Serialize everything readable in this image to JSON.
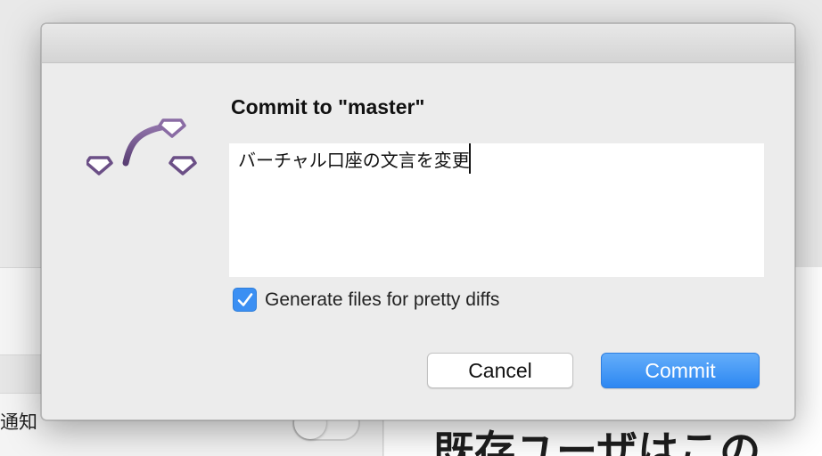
{
  "background": {
    "left_label": "通知",
    "right_heading": "既存ユーザはこの"
  },
  "dialog": {
    "title": "Commit to \"master\"",
    "message": "バーチャル口座の文言を変更",
    "generate_files_checked": true,
    "generate_files_label": "Generate files for pretty diffs",
    "cancel_label": "Cancel",
    "commit_label": "Commit"
  },
  "colors": {
    "accent": "#3b8ff3",
    "icon_purple": "#6b4f86"
  },
  "icons": {
    "app_icon": "git-branch-diamonds-icon",
    "checkmark": "checkmark-icon"
  }
}
